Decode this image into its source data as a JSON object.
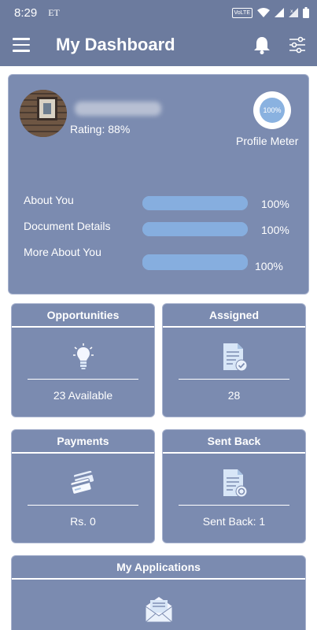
{
  "status_bar": {
    "time": "8:29",
    "carrier": "ET",
    "volte": "VoLTE"
  },
  "app_bar": {
    "title": "My Dashboard"
  },
  "profile": {
    "rating_label": "Rating:  88%",
    "meter_value": "100%",
    "meter_label": "Profile Meter",
    "progress": [
      {
        "label": "About You",
        "value": "100%",
        "fraction": 1.0
      },
      {
        "label": "Document Details",
        "value": "100%",
        "fraction": 1.0
      },
      {
        "label": "More About You",
        "value": "100%",
        "fraction": 1.0
      }
    ]
  },
  "tiles": {
    "opportunities": {
      "title": "Opportunities",
      "value": "23 Available",
      "icon": "lightbulb-icon"
    },
    "assigned": {
      "title": "Assigned",
      "value": "28",
      "icon": "document-check-icon"
    },
    "payments": {
      "title": "Payments",
      "value": "Rs. 0",
      "icon": "credit-cards-icon"
    },
    "sent_back": {
      "title": "Sent Back",
      "value": "Sent Back: 1",
      "icon": "document-return-icon"
    },
    "my_applications": {
      "title": "My Applications",
      "icon": "envelope-icon"
    }
  },
  "colors": {
    "primary": "#6c7b9e",
    "card": "#7b8bb0",
    "progress": "#8ab2e0"
  }
}
